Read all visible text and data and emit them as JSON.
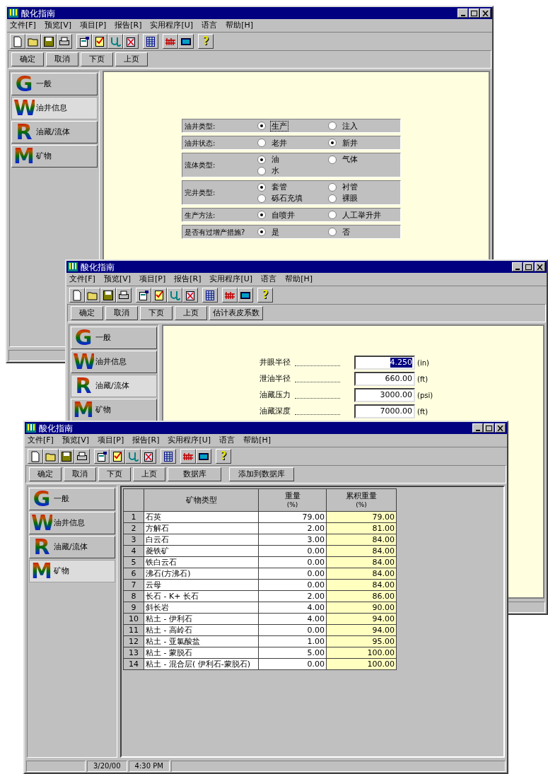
{
  "windows": [
    {
      "title": "酸化指南",
      "menu": [
        "文件[F]",
        "预览[V]",
        "项目[P]",
        "报告[R]",
        "实用程序[U]",
        "语言",
        "帮助[H]"
      ],
      "toolbar": [
        [
          {
            "kind": "new"
          },
          {
            "kind": "open"
          },
          {
            "kind": "save"
          },
          {
            "kind": "print"
          }
        ],
        [
          {
            "kind": "properties"
          },
          {
            "kind": "checklist"
          },
          {
            "kind": "stethoscope"
          },
          {
            "kind": "rx"
          }
        ],
        [
          {
            "kind": "grid"
          }
        ],
        [
          {
            "kind": "ruler"
          },
          {
            "kind": "monitor"
          }
        ],
        [
          {
            "kind": "help",
            "text": "?"
          }
        ]
      ],
      "buttons": [
        {
          "label": "确定",
          "wide": false
        },
        {
          "label": "取消",
          "wide": false
        },
        {
          "label": "下页",
          "wide": false
        },
        {
          "label": "上页",
          "wide": false
        }
      ],
      "sidebar": [
        {
          "letter": "G",
          "label": "一般",
          "selected": false
        },
        {
          "letter": "W",
          "label": "油井信息",
          "selected": true
        },
        {
          "letter": "R",
          "label": "油藏/流体",
          "selected": false
        },
        {
          "letter": "M",
          "label": "矿物",
          "selected": false
        }
      ],
      "content": {
        "kind": "radio_form",
        "rows": [
          {
            "label": "油井类型:",
            "options": [
              {
                "label": "生产",
                "selected": true,
                "focused": true
              },
              {
                "label": "注入",
                "selected": false,
                "focused": false
              }
            ]
          },
          {
            "label": "油井状态:",
            "options": [
              {
                "label": "老井",
                "selected": false,
                "focused": false
              },
              {
                "label": "新井",
                "selected": true,
                "focused": false
              }
            ]
          },
          {
            "label": "流体类型:",
            "options": [
              {
                "label": "油",
                "selected": true,
                "focused": false
              },
              {
                "label": "气体",
                "selected": false,
                "focused": false
              },
              {
                "label": "水",
                "selected": false,
                "focused": false
              }
            ]
          },
          {
            "label": "完井类型:",
            "options": [
              {
                "label": "套管",
                "selected": true,
                "focused": false
              },
              {
                "label": "衬管",
                "selected": false,
                "focused": false
              },
              {
                "label": "砾石充填",
                "selected": false,
                "focused": false
              },
              {
                "label": "裸眼",
                "selected": false,
                "focused": false
              }
            ]
          },
          {
            "label": "生产方法:",
            "options": [
              {
                "label": "自喷井",
                "selected": true,
                "focused": false
              },
              {
                "label": "人工举升井",
                "selected": false,
                "focused": false
              }
            ]
          },
          {
            "label": "是否有过增产措施?",
            "options": [
              {
                "label": "是",
                "selected": true,
                "focused": false
              },
              {
                "label": "否",
                "selected": false,
                "focused": false
              }
            ]
          }
        ]
      }
    },
    {
      "title": "酸化指南",
      "menu": [
        "文件[F]",
        "预览[V]",
        "项目[P]",
        "报告[R]",
        "实用程序[U]",
        "语言",
        "帮助[H]"
      ],
      "toolbar": [
        [
          {
            "kind": "new"
          },
          {
            "kind": "open"
          },
          {
            "kind": "save"
          },
          {
            "kind": "print"
          }
        ],
        [
          {
            "kind": "properties"
          },
          {
            "kind": "checklist"
          },
          {
            "kind": "stethoscope"
          },
          {
            "kind": "rx"
          }
        ],
        [
          {
            "kind": "grid"
          }
        ],
        [
          {
            "kind": "ruler"
          },
          {
            "kind": "monitor"
          }
        ],
        [
          {
            "kind": "help",
            "text": "?"
          }
        ]
      ],
      "buttons": [
        {
          "label": "确定",
          "wide": false
        },
        {
          "label": "取消",
          "wide": false
        },
        {
          "label": "下页",
          "wide": false
        },
        {
          "label": "上页",
          "wide": false
        },
        {
          "label": "估计表皮系数",
          "wide": false
        }
      ],
      "sidebar": [
        {
          "letter": "G",
          "label": "一般",
          "selected": false
        },
        {
          "letter": "W",
          "label": "油井信息",
          "selected": false
        },
        {
          "letter": "R",
          "label": "油藏/流体",
          "selected": true
        },
        {
          "letter": "M",
          "label": "矿物",
          "selected": false
        }
      ],
      "content": {
        "kind": "field_form",
        "fields": [
          {
            "label": "井眼半径",
            "value": "4.250",
            "unit": "(in)",
            "highlighted": true
          },
          {
            "label": "泄油半径",
            "value": "660.00",
            "unit": "(ft)",
            "highlighted": false
          },
          {
            "label": "油藏压力",
            "value": "3000.00",
            "unit": "(psi)",
            "highlighted": false
          },
          {
            "label": "油藏深度",
            "value": "7000.00",
            "unit": "(ft)",
            "highlighted": false
          }
        ]
      }
    },
    {
      "title": "酸化指南",
      "menu": [
        "文件[F]",
        "预览[V]",
        "项目[P]",
        "报告[R]",
        "实用程序[U]",
        "语言",
        "帮助[H]"
      ],
      "toolbar": [
        [
          {
            "kind": "new"
          },
          {
            "kind": "open"
          },
          {
            "kind": "save"
          },
          {
            "kind": "print"
          }
        ],
        [
          {
            "kind": "properties"
          },
          {
            "kind": "checklist"
          },
          {
            "kind": "stethoscope"
          },
          {
            "kind": "rx"
          }
        ],
        [
          {
            "kind": "grid"
          }
        ],
        [
          {
            "kind": "ruler"
          },
          {
            "kind": "monitor"
          }
        ],
        [
          {
            "kind": "help",
            "text": "?"
          }
        ]
      ],
      "buttons": [
        {
          "label": "确定",
          "wide": false
        },
        {
          "label": "取消",
          "wide": false
        },
        {
          "label": "下页",
          "wide": false
        },
        {
          "label": "上页",
          "wide": false
        },
        {
          "label": "数据库",
          "wide": true
        },
        {
          "label": "添加到数据库",
          "wide": true
        }
      ],
      "sidebar": [
        {
          "letter": "G",
          "label": "一般",
          "selected": false
        },
        {
          "letter": "W",
          "label": "油井信息",
          "selected": false
        },
        {
          "letter": "R",
          "label": "油藏/流体",
          "selected": false
        },
        {
          "letter": "M",
          "label": "矿物",
          "selected": true
        }
      ],
      "content": {
        "kind": "table",
        "columns": [
          {
            "title": "矿物类型",
            "computed": false
          },
          {
            "title": "重量",
            "unit": "(%)",
            "computed": false
          },
          {
            "title": "累积重量",
            "unit": "(%)",
            "computed": true
          }
        ],
        "rows": [
          {
            "no": "1",
            "name": "石英",
            "weight": "79.00",
            "cumulative": "79.00"
          },
          {
            "no": "2",
            "name": "方解石",
            "weight": "2.00",
            "cumulative": "81.00"
          },
          {
            "no": "3",
            "name": "白云石",
            "weight": "3.00",
            "cumulative": "84.00"
          },
          {
            "no": "4",
            "name": "菱铁矿",
            "weight": "0.00",
            "cumulative": "84.00"
          },
          {
            "no": "5",
            "name": "铁白云石",
            "weight": "0.00",
            "cumulative": "84.00"
          },
          {
            "no": "6",
            "name": "沸石(方沸石)",
            "weight": "0.00",
            "cumulative": "84.00"
          },
          {
            "no": "7",
            "name": "云母",
            "weight": "0.00",
            "cumulative": "84.00"
          },
          {
            "no": "8",
            "name": "长石 - K+ 长石",
            "weight": "2.00",
            "cumulative": "86.00"
          },
          {
            "no": "9",
            "name": "斜长岩",
            "weight": "4.00",
            "cumulative": "90.00"
          },
          {
            "no": "10",
            "name": "粘土 - 伊利石",
            "weight": "4.00",
            "cumulative": "94.00"
          },
          {
            "no": "11",
            "name": "粘土 - 高岭石",
            "weight": "0.00",
            "cumulative": "94.00"
          },
          {
            "no": "12",
            "name": "粘土 - 亚氯酸盐",
            "weight": "1.00",
            "cumulative": "95.00"
          },
          {
            "no": "13",
            "name": "粘土 - 蒙脱石",
            "weight": "5.00",
            "cumulative": "100.00"
          },
          {
            "no": "14",
            "name": "粘土 - 混合层( 伊利石-蒙脱石)",
            "weight": "0.00",
            "cumulative": "100.00"
          }
        ]
      },
      "status_bar": [
        "3/20/00",
        "4:30 PM"
      ]
    }
  ]
}
